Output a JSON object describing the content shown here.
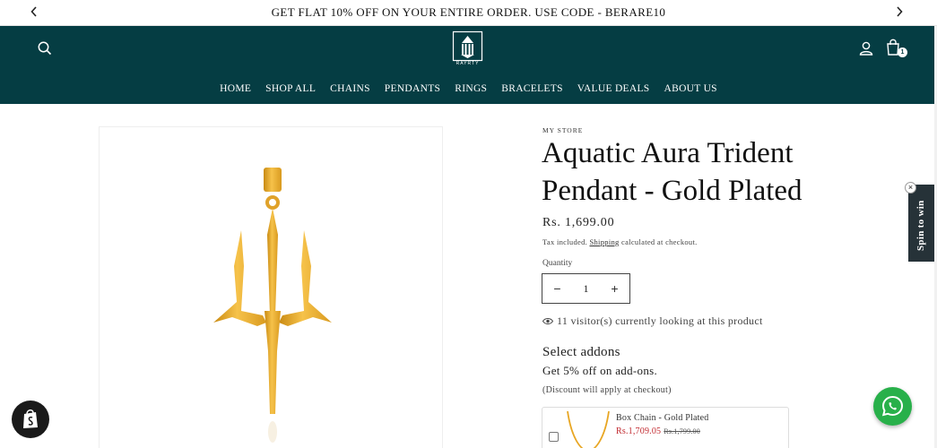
{
  "announcement": {
    "text": "GET FLAT 10% OFF ON YOUR ENTIRE ORDER. USE CODE - BERARE10",
    "prev_icon": "chevron-left-icon",
    "next_icon": "chevron-right-icon"
  },
  "header": {
    "brand_logo_text": "RAYRTY",
    "cart_count": "1",
    "icons": [
      "search-icon",
      "account-icon",
      "cart-icon"
    ],
    "background_color": "#053d43"
  },
  "nav": {
    "items": [
      "HOME",
      "SHOP ALL",
      "CHAINS",
      "PENDANTS",
      "RINGS",
      "BRACELETS",
      "VALUE DEALS",
      "ABOUT US"
    ]
  },
  "product": {
    "vendor": "MY STORE",
    "title": "Aquatic Aura Trident Pendant - Gold Plated",
    "price": "Rs. 1,699.00",
    "tax_prefix": "Tax included.",
    "tax_link": "Shipping",
    "tax_suffix": "calculated at checkout.",
    "quantity_label": "Quantity",
    "quantity_value": "1",
    "decrease_symbol": "−",
    "increase_symbol": "+",
    "visitors_text": "11 visitor(s) currently looking at this product"
  },
  "addons": {
    "title": "Select addons",
    "subtitle": "Get 5% off on add-ons.",
    "note": "(Discount will apply at checkout)",
    "items": [
      {
        "name": "Box Chain - Gold Plated",
        "price": "Rs.1,709.05",
        "compare_price": "Rs.1,799.00",
        "checked": false
      }
    ]
  },
  "widgets": {
    "spin_label": "Spin to win",
    "spin_close": "×",
    "whatsapp_icon": "whatsapp-icon",
    "shopify_icon": "shopify-bag-icon"
  },
  "colors": {
    "header_bg": "#053d43",
    "gold": "#e8a623",
    "sale_red": "#c1272d",
    "whatsapp_green": "#28b04a"
  }
}
